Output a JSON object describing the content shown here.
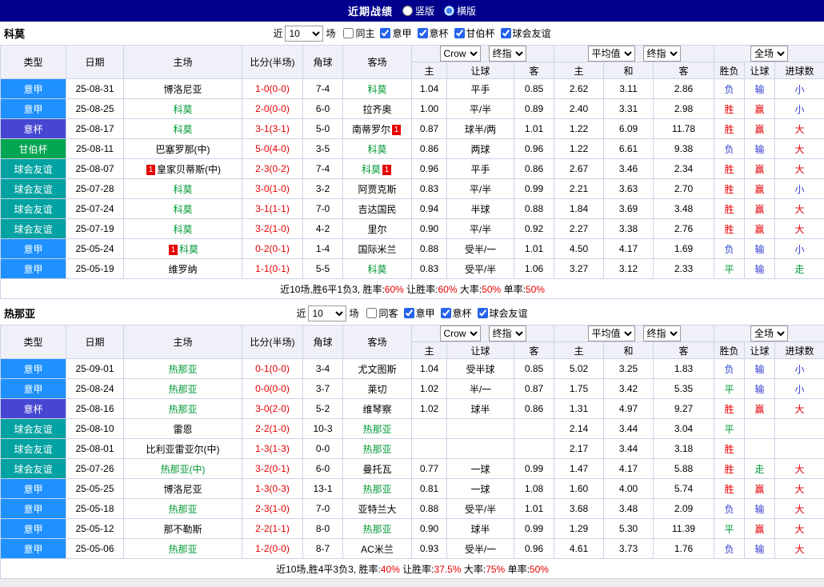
{
  "topbar": {
    "title": "近期战绩",
    "radios": [
      {
        "label": "竖版",
        "selected": false
      },
      {
        "label": "横版",
        "selected": true
      }
    ]
  },
  "colors": {
    "topbar_bg": "#00008c",
    "header_bg": "#f0f1f8",
    "border": "#ccd3e6",
    "score": "#e60000",
    "focus_team": "#009933",
    "red": "#e60000",
    "blue": "#3340d0",
    "green": "#009933",
    "type_colors": {
      "意甲": "#1e90ff",
      "意杯": "#4646d2",
      "甘伯杯": "#00a651",
      "球会友谊": "#00a2a2"
    }
  },
  "status_color_map": {
    "胜": "red",
    "平": "green",
    "负": "blue",
    "赢": "red",
    "走": "green",
    "输": "blue",
    "大": "red",
    "小": "blue"
  },
  "table": {
    "main_cols": [
      "类型",
      "日期",
      "主场",
      "比分(半场)",
      "角球",
      "客场"
    ],
    "sub_cols": [
      "主",
      "让球",
      "客",
      "主",
      "和",
      "客",
      "胜负",
      "让球",
      "进球数"
    ],
    "selects": {
      "bookmaker": "Crow",
      "asia_stage": "终指",
      "average": "平均值",
      "euro_stage": "终指",
      "scope": "全场"
    }
  },
  "sections": [
    {
      "team": "科莫",
      "filter": {
        "prefix": "近",
        "count": "10",
        "suffix": "场",
        "checkboxes": [
          {
            "label": "同主",
            "checked": false
          },
          {
            "label": "意甲",
            "checked": true
          },
          {
            "label": "意杯",
            "checked": true
          },
          {
            "label": "甘伯杯",
            "checked": true
          },
          {
            "label": "球会友谊",
            "checked": true
          }
        ]
      },
      "rows": [
        {
          "type": "意甲",
          "date": "25-08-31",
          "home": {
            "name": "博洛尼亚",
            "focus": false,
            "card": ""
          },
          "score": "1-0(0-0)",
          "corner": "7-4",
          "away": {
            "name": "科莫",
            "focus": true,
            "card": ""
          },
          "asia": [
            "1.04",
            "平手",
            "0.85"
          ],
          "euro": [
            "2.62",
            "3.11",
            "2.86"
          ],
          "result": [
            "负",
            "输",
            "小"
          ]
        },
        {
          "type": "意甲",
          "date": "25-08-25",
          "home": {
            "name": "科莫",
            "focus": true,
            "card": ""
          },
          "score": "2-0(0-0)",
          "corner": "6-0",
          "away": {
            "name": "拉齐奥",
            "focus": false,
            "card": ""
          },
          "asia": [
            "1.00",
            "平/半",
            "0.89"
          ],
          "euro": [
            "2.40",
            "3.31",
            "2.98"
          ],
          "result": [
            "胜",
            "赢",
            "小"
          ]
        },
        {
          "type": "意杯",
          "date": "25-08-17",
          "home": {
            "name": "科莫",
            "focus": true,
            "card": ""
          },
          "score": "3-1(3-1)",
          "corner": "5-0",
          "away": {
            "name": "南蒂罗尔",
            "focus": false,
            "card": "1"
          },
          "asia": [
            "0.87",
            "球半/两",
            "1.01"
          ],
          "euro": [
            "1.22",
            "6.09",
            "11.78"
          ],
          "result": [
            "胜",
            "赢",
            "大"
          ]
        },
        {
          "type": "甘伯杯",
          "date": "25-08-11",
          "home": {
            "name": "巴塞罗那(中)",
            "focus": false,
            "card": ""
          },
          "score": "5-0(4-0)",
          "corner": "3-5",
          "away": {
            "name": "科莫",
            "focus": true,
            "card": ""
          },
          "asia": [
            "0.86",
            "两球",
            "0.96"
          ],
          "euro": [
            "1.22",
            "6.61",
            "9.38"
          ],
          "result": [
            "负",
            "输",
            "大"
          ]
        },
        {
          "type": "球会友谊",
          "date": "25-08-07",
          "home": {
            "name": "皇家贝蒂斯(中)",
            "focus": false,
            "card": "1"
          },
          "score": "2-3(0-2)",
          "corner": "7-4",
          "away": {
            "name": "科莫",
            "focus": true,
            "card": "1"
          },
          "asia": [
            "0.96",
            "平手",
            "0.86"
          ],
          "euro": [
            "2.67",
            "3.46",
            "2.34"
          ],
          "result": [
            "胜",
            "赢",
            "大"
          ]
        },
        {
          "type": "球会友谊",
          "date": "25-07-28",
          "home": {
            "name": "科莫",
            "focus": true,
            "card": ""
          },
          "score": "3-0(1-0)",
          "corner": "3-2",
          "away": {
            "name": "阿贾克斯",
            "focus": false,
            "card": ""
          },
          "asia": [
            "0.83",
            "平/半",
            "0.99"
          ],
          "euro": [
            "2.21",
            "3.63",
            "2.70"
          ],
          "result": [
            "胜",
            "赢",
            "小"
          ]
        },
        {
          "type": "球会友谊",
          "date": "25-07-24",
          "home": {
            "name": "科莫",
            "focus": true,
            "card": ""
          },
          "score": "3-1(1-1)",
          "corner": "7-0",
          "away": {
            "name": "吉达国民",
            "focus": false,
            "card": ""
          },
          "asia": [
            "0.94",
            "半球",
            "0.88"
          ],
          "euro": [
            "1.84",
            "3.69",
            "3.48"
          ],
          "result": [
            "胜",
            "赢",
            "大"
          ]
        },
        {
          "type": "球会友谊",
          "date": "25-07-19",
          "home": {
            "name": "科莫",
            "focus": true,
            "card": ""
          },
          "score": "3-2(1-0)",
          "corner": "4-2",
          "away": {
            "name": "里尔",
            "focus": false,
            "card": ""
          },
          "asia": [
            "0.90",
            "平/半",
            "0.92"
          ],
          "euro": [
            "2.27",
            "3.38",
            "2.76"
          ],
          "result": [
            "胜",
            "赢",
            "大"
          ]
        },
        {
          "type": "意甲",
          "date": "25-05-24",
          "home": {
            "name": "科莫",
            "focus": true,
            "card": "1"
          },
          "score": "0-2(0-1)",
          "corner": "1-4",
          "away": {
            "name": "国际米兰",
            "focus": false,
            "card": ""
          },
          "asia": [
            "0.88",
            "受半/一",
            "1.01"
          ],
          "euro": [
            "4.50",
            "4.17",
            "1.69"
          ],
          "result": [
            "负",
            "输",
            "小"
          ]
        },
        {
          "type": "意甲",
          "date": "25-05-19",
          "home": {
            "name": "维罗纳",
            "focus": false,
            "card": ""
          },
          "score": "1-1(0-1)",
          "corner": "5-5",
          "away": {
            "name": "科莫",
            "focus": true,
            "card": ""
          },
          "asia": [
            "0.83",
            "受平/半",
            "1.06"
          ],
          "euro": [
            "3.27",
            "3.12",
            "2.33"
          ],
          "result": [
            "平",
            "输",
            "走"
          ]
        }
      ],
      "summary": [
        {
          "text": "近10场,胜6平1负3, 胜率:",
          "red": false
        },
        {
          "text": "60%",
          "red": true
        },
        {
          "text": " 让胜率:",
          "red": false
        },
        {
          "text": "60%",
          "red": true
        },
        {
          "text": " 大率:",
          "red": false
        },
        {
          "text": "50%",
          "red": true
        },
        {
          "text": " 单率:",
          "red": false
        },
        {
          "text": "50%",
          "red": true
        }
      ]
    },
    {
      "team": "热那亚",
      "filter": {
        "prefix": "近",
        "count": "10",
        "suffix": "场",
        "checkboxes": [
          {
            "label": "同客",
            "checked": false
          },
          {
            "label": "意甲",
            "checked": true
          },
          {
            "label": "意杯",
            "checked": true
          },
          {
            "label": "球会友谊",
            "checked": true
          }
        ]
      },
      "rows": [
        {
          "type": "意甲",
          "date": "25-09-01",
          "home": {
            "name": "热那亚",
            "focus": true,
            "card": ""
          },
          "score": "0-1(0-0)",
          "corner": "3-4",
          "away": {
            "name": "尤文图斯",
            "focus": false,
            "card": ""
          },
          "asia": [
            "1.04",
            "受半球",
            "0.85"
          ],
          "euro": [
            "5.02",
            "3.25",
            "1.83"
          ],
          "result": [
            "负",
            "输",
            "小"
          ]
        },
        {
          "type": "意甲",
          "date": "25-08-24",
          "home": {
            "name": "热那亚",
            "focus": true,
            "card": ""
          },
          "score": "0-0(0-0)",
          "corner": "3-7",
          "away": {
            "name": "莱切",
            "focus": false,
            "card": ""
          },
          "asia": [
            "1.02",
            "半/一",
            "0.87"
          ],
          "euro": [
            "1.75",
            "3.42",
            "5.35"
          ],
          "result": [
            "平",
            "输",
            "小"
          ]
        },
        {
          "type": "意杯",
          "date": "25-08-16",
          "home": {
            "name": "热那亚",
            "focus": true,
            "card": ""
          },
          "score": "3-0(2-0)",
          "corner": "5-2",
          "away": {
            "name": "维琴察",
            "focus": false,
            "card": ""
          },
          "asia": [
            "1.02",
            "球半",
            "0.86"
          ],
          "euro": [
            "1.31",
            "4.97",
            "9.27"
          ],
          "result": [
            "胜",
            "赢",
            "大"
          ]
        },
        {
          "type": "球会友谊",
          "date": "25-08-10",
          "home": {
            "name": "雷恩",
            "focus": false,
            "card": ""
          },
          "score": "2-2(1-0)",
          "corner": "10-3",
          "away": {
            "name": "热那亚",
            "focus": true,
            "card": ""
          },
          "asia": [
            "",
            "",
            ""
          ],
          "euro": [
            "2.14",
            "3.44",
            "3.04"
          ],
          "result": [
            "平",
            "",
            ""
          ]
        },
        {
          "type": "球会友谊",
          "date": "25-08-01",
          "home": {
            "name": "比利亚雷亚尔(中)",
            "focus": false,
            "card": ""
          },
          "score": "1-3(1-3)",
          "corner": "0-0",
          "away": {
            "name": "热那亚",
            "focus": true,
            "card": ""
          },
          "asia": [
            "",
            "",
            ""
          ],
          "euro": [
            "2.17",
            "3.44",
            "3.18"
          ],
          "result": [
            "胜",
            "",
            ""
          ]
        },
        {
          "type": "球会友谊",
          "date": "25-07-26",
          "home": {
            "name": "热那亚(中)",
            "focus": true,
            "card": ""
          },
          "score": "3-2(0-1)",
          "corner": "6-0",
          "away": {
            "name": "曼托瓦",
            "focus": false,
            "card": ""
          },
          "asia": [
            "0.77",
            "一球",
            "0.99"
          ],
          "euro": [
            "1.47",
            "4.17",
            "5.88"
          ],
          "result": [
            "胜",
            "走",
            "大"
          ]
        },
        {
          "type": "意甲",
          "date": "25-05-25",
          "home": {
            "name": "博洛尼亚",
            "focus": false,
            "card": ""
          },
          "score": "1-3(0-3)",
          "corner": "13-1",
          "away": {
            "name": "热那亚",
            "focus": true,
            "card": ""
          },
          "asia": [
            "0.81",
            "一球",
            "1.08"
          ],
          "euro": [
            "1.60",
            "4.00",
            "5.74"
          ],
          "result": [
            "胜",
            "赢",
            "大"
          ]
        },
        {
          "type": "意甲",
          "date": "25-05-18",
          "home": {
            "name": "热那亚",
            "focus": true,
            "card": ""
          },
          "score": "2-3(1-0)",
          "corner": "7-0",
          "away": {
            "name": "亚特兰大",
            "focus": false,
            "card": ""
          },
          "asia": [
            "0.88",
            "受平/半",
            "1.01"
          ],
          "euro": [
            "3.68",
            "3.48",
            "2.09"
          ],
          "result": [
            "负",
            "输",
            "大"
          ]
        },
        {
          "type": "意甲",
          "date": "25-05-12",
          "home": {
            "name": "那不勒斯",
            "focus": false,
            "card": ""
          },
          "score": "2-2(1-1)",
          "corner": "8-0",
          "away": {
            "name": "热那亚",
            "focus": true,
            "card": ""
          },
          "asia": [
            "0.90",
            "球半",
            "0.99"
          ],
          "euro": [
            "1.29",
            "5.30",
            "11.39"
          ],
          "result": [
            "平",
            "赢",
            "大"
          ]
        },
        {
          "type": "意甲",
          "date": "25-05-06",
          "home": {
            "name": "热那亚",
            "focus": true,
            "card": ""
          },
          "score": "1-2(0-0)",
          "corner": "8-7",
          "away": {
            "name": "AC米兰",
            "focus": false,
            "card": ""
          },
          "asia": [
            "0.93",
            "受半/一",
            "0.96"
          ],
          "euro": [
            "4.61",
            "3.73",
            "1.76"
          ],
          "result": [
            "负",
            "输",
            "大"
          ]
        }
      ],
      "summary": [
        {
          "text": "近10场,胜4平3负3, 胜率:",
          "red": false
        },
        {
          "text": "40%",
          "red": true
        },
        {
          "text": " 让胜率:",
          "red": false
        },
        {
          "text": "37.5%",
          "red": true
        },
        {
          "text": " 大率:",
          "red": false
        },
        {
          "text": "75%",
          "red": true
        },
        {
          "text": " 单率:",
          "red": false
        },
        {
          "text": "50%",
          "red": true
        }
      ]
    }
  ]
}
